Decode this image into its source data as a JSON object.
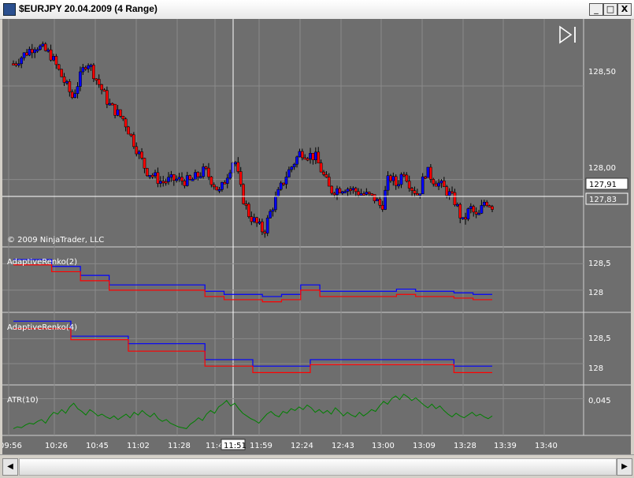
{
  "window": {
    "title": "$EURJPY  20.04.2009 (4 Range)",
    "minimize": "_",
    "maximize": "□",
    "close": "X"
  },
  "colors": {
    "background": "#6e6e6e",
    "grid": "#8a8a8a",
    "up_candle": "#0000ff",
    "down_candle": "#ff0000",
    "renko_upper": "#0000ff",
    "renko_lower": "#ff0000",
    "atr": "#008000",
    "axis_text": "#ffffff"
  },
  "icons": {
    "play_end": "skip-to-end-icon"
  },
  "chart_data": [
    {
      "type": "candlestick",
      "title": "",
      "copyright": "© 2009 NinjaTrader, LLC",
      "xlabel": "",
      "ylabel": "",
      "ylim": [
        127.64,
        128.85
      ],
      "yticks": [
        "128,50",
        "128,00"
      ],
      "ytick_values": [
        128.5,
        128.0
      ],
      "crosshair_price": "127,91",
      "crosshair_time": "11:51",
      "last_price": "127,83",
      "close_path": [
        [
          0,
          128.62
        ],
        [
          6,
          128.72
        ],
        [
          10,
          128.67
        ],
        [
          16,
          128.44
        ],
        [
          20,
          128.64
        ],
        [
          26,
          128.4
        ],
        [
          30,
          128.32
        ],
        [
          36,
          128.05
        ],
        [
          40,
          127.99
        ],
        [
          44,
          128.0
        ],
        [
          48,
          127.99
        ],
        [
          52,
          128.05
        ],
        [
          56,
          127.93
        ],
        [
          60,
          128.12
        ],
        [
          62,
          127.92
        ],
        [
          64,
          127.81
        ],
        [
          68,
          127.72
        ],
        [
          70,
          127.84
        ],
        [
          74,
          128.02
        ],
        [
          78,
          128.15
        ],
        [
          82,
          128.12
        ],
        [
          86,
          127.94
        ],
        [
          90,
          127.96
        ],
        [
          94,
          127.93
        ],
        [
          98,
          127.9
        ],
        [
          100,
          127.85
        ],
        [
          102,
          128.02
        ],
        [
          104,
          127.97
        ],
        [
          106,
          128.05
        ],
        [
          108,
          127.96
        ],
        [
          110,
          127.92
        ],
        [
          112,
          128.05
        ],
        [
          114,
          128.0
        ],
        [
          116,
          127.97
        ],
        [
          118,
          127.93
        ],
        [
          120,
          127.88
        ],
        [
          122,
          127.77
        ],
        [
          124,
          127.85
        ],
        [
          126,
          127.79
        ],
        [
          128,
          127.89
        ],
        [
          130,
          127.86
        ]
      ]
    },
    {
      "type": "line",
      "title": "AdaptiveRenko(2)",
      "yticks": [
        "128,5",
        "128"
      ],
      "ytick_values": [
        128.5,
        128.0
      ],
      "series": [
        {
          "name": "",
          "values": [
            [
              0,
              128.58
            ],
            [
              8,
              128.45
            ],
            [
              14,
              128.28
            ],
            [
              20,
              128.1
            ],
            [
              40,
              127.98
            ],
            [
              44,
              127.92
            ],
            [
              52,
              127.88
            ],
            [
              56,
              127.92
            ],
            [
              60,
              128.1
            ],
            [
              64,
              127.98
            ],
            [
              72,
              127.98
            ],
            [
              80,
              128.02
            ],
            [
              84,
              127.98
            ],
            [
              92,
              127.95
            ],
            [
              96,
              127.92
            ],
            [
              100,
              127.92
            ]
          ]
        },
        {
          "name": "",
          "values": [
            [
              0,
              128.48
            ],
            [
              8,
              128.35
            ],
            [
              14,
              128.18
            ],
            [
              20,
              128.0
            ],
            [
              40,
              127.88
            ],
            [
              44,
              127.82
            ],
            [
              52,
              127.78
            ],
            [
              56,
              127.82
            ],
            [
              60,
              128.0
            ],
            [
              64,
              127.88
            ],
            [
              72,
              127.88
            ],
            [
              80,
              127.92
            ],
            [
              84,
              127.88
            ],
            [
              92,
              127.85
            ],
            [
              96,
              127.82
            ],
            [
              100,
              127.82
            ]
          ]
        }
      ]
    },
    {
      "type": "line",
      "title": "AdaptiveRenko(4)",
      "yticks": [
        "128,5",
        "128"
      ],
      "ytick_values": [
        128.5,
        128.0
      ],
      "series": [
        {
          "name": "",
          "values": [
            [
              0,
              128.85
            ],
            [
              12,
              128.55
            ],
            [
              24,
              128.4
            ],
            [
              40,
              128.08
            ],
            [
              50,
              127.95
            ],
            [
              62,
              128.08
            ],
            [
              92,
              127.95
            ],
            [
              100,
              127.95
            ]
          ]
        },
        {
          "name": "",
          "values": [
            [
              0,
              128.7
            ],
            [
              12,
              128.48
            ],
            [
              24,
              128.25
            ],
            [
              40,
              127.95
            ],
            [
              50,
              127.82
            ],
            [
              62,
              127.98
            ],
            [
              92,
              127.82
            ],
            [
              100,
              127.82
            ]
          ]
        }
      ]
    },
    {
      "type": "line",
      "title": "ATR(10)",
      "yticks": [
        "0,045"
      ],
      "ytick_values": [
        0.045
      ],
      "series": [
        {
          "name": "",
          "values": [
            0.012,
            0.014,
            0.013,
            0.016,
            0.018,
            0.017,
            0.02,
            0.022,
            0.018,
            0.025,
            0.03,
            0.028,
            0.033,
            0.029,
            0.036,
            0.04,
            0.034,
            0.031,
            0.027,
            0.033,
            0.03,
            0.026,
            0.028,
            0.025,
            0.023,
            0.026,
            0.022,
            0.025,
            0.028,
            0.024,
            0.03,
            0.027,
            0.032,
            0.028,
            0.025,
            0.029,
            0.023,
            0.02,
            0.022,
            0.018,
            0.016,
            0.014,
            0.013,
            0.012,
            0.017,
            0.02,
            0.024,
            0.021,
            0.028,
            0.032,
            0.029,
            0.036,
            0.039,
            0.043,
            0.037,
            0.04,
            0.034,
            0.029,
            0.026,
            0.023,
            0.021,
            0.018,
            0.023,
            0.028,
            0.031,
            0.027,
            0.025,
            0.031,
            0.029,
            0.034,
            0.032,
            0.036,
            0.033,
            0.038,
            0.035,
            0.03,
            0.033,
            0.029,
            0.032,
            0.028,
            0.035,
            0.031,
            0.026,
            0.03,
            0.027,
            0.025,
            0.03,
            0.026,
            0.029,
            0.033,
            0.031,
            0.037,
            0.042,
            0.039,
            0.045,
            0.048,
            0.044,
            0.05,
            0.047,
            0.043,
            0.046,
            0.042,
            0.038,
            0.035,
            0.039,
            0.034,
            0.037,
            0.032,
            0.028,
            0.025,
            0.029,
            0.026,
            0.024,
            0.027,
            0.03,
            0.026,
            0.028,
            0.025,
            0.023,
            0.026
          ]
        }
      ]
    }
  ],
  "time_axis": {
    "labels": [
      "09:56",
      "10:26",
      "10:45",
      "11:02",
      "11:28",
      "11:4",
      "11:59",
      "12:24",
      "12:43",
      "13:00",
      "13:09",
      "13:28",
      "13:39",
      "13:40"
    ],
    "cursor_label": "11:51"
  },
  "scrollbar": {
    "left_arrow": "◀",
    "right_arrow": "▶"
  }
}
